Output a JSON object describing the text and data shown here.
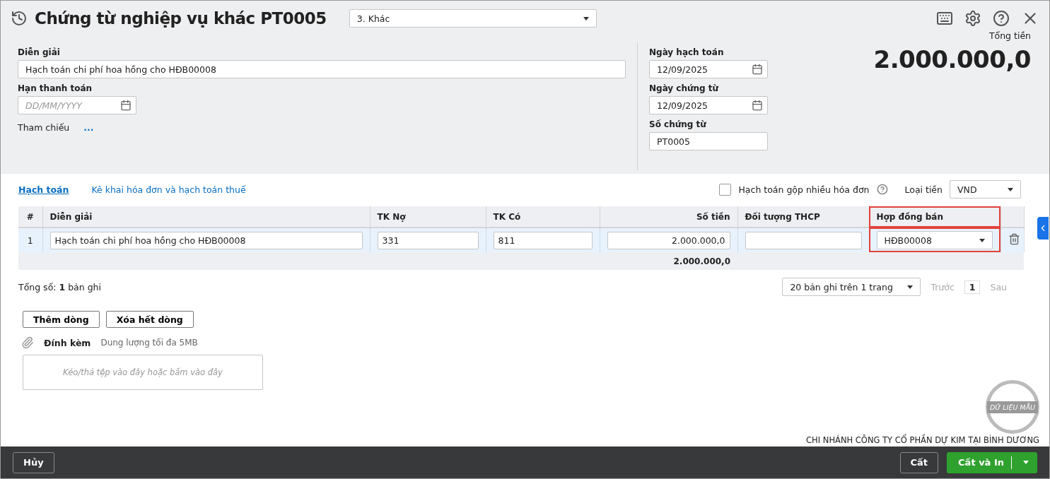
{
  "header": {
    "title": "Chứng từ nghiệp vụ khác PT0005",
    "voucher_type": "3. Khác"
  },
  "form": {
    "description": {
      "label": "Diễn giải",
      "value": "Hạch toán chi phí hoa hồng cho HĐB00008"
    },
    "due_date": {
      "label": "Hạn thanh toán",
      "placeholder": "DD/MM/YYYY"
    },
    "reference": {
      "label": "Tham chiếu",
      "link": "..."
    },
    "posting_date": {
      "label": "Ngày hạch toán",
      "value": "12/09/2025"
    },
    "voucher_date": {
      "label": "Ngày chứng từ",
      "value": "12/09/2025"
    },
    "voucher_no": {
      "label": "Số chứng từ",
      "value": "PT0005"
    },
    "total": {
      "label": "Tổng tiền",
      "value": "2.000.000,0"
    }
  },
  "tabs": [
    {
      "label": "Hạch toán",
      "selected": true
    },
    {
      "label": "Kê khai hóa đơn và hạch toán thuế",
      "selected": false
    }
  ],
  "options": {
    "merge": {
      "label": "Hạch toán gộp nhiều hóa đơn",
      "checked": false
    },
    "currency": {
      "label": "Loại tiền",
      "value": "VND"
    }
  },
  "table": {
    "columns": [
      {
        "label": "#",
        "highlighted": false
      },
      {
        "label": "Diễn giải",
        "highlighted": false
      },
      {
        "label": "TK Nợ",
        "highlighted": false
      },
      {
        "label": "TK Có",
        "highlighted": false
      },
      {
        "label": "Số tiền",
        "highlighted": false
      },
      {
        "label": "Đối tượng THCP",
        "highlighted": false
      },
      {
        "label": "Hợp đồng bán",
        "highlighted": true
      }
    ],
    "rows": [
      {
        "cells": [
          {
            "kind": "index",
            "value": "1"
          },
          {
            "kind": "text",
            "value": "Hạch toán chi phí hoa hồng cho HĐB00008"
          },
          {
            "kind": "text",
            "value": "331"
          },
          {
            "kind": "text",
            "value": "811"
          },
          {
            "kind": "number",
            "value": "2.000.000,0"
          },
          {
            "kind": "text"
          },
          {
            "kind": "select",
            "value": "HĐB00008"
          }
        ]
      }
    ],
    "total": "2.000.000,0"
  },
  "summary": "Tổng số: **1** bản ghi",
  "pager": {
    "page_size": "20 bản ghi trên 1 trang",
    "prev": "Trước",
    "page": "1",
    "next": "Sau"
  },
  "row_buttons": [
    "Thêm dòng",
    "Xóa hết dòng"
  ],
  "attachment": {
    "label": "Đính kèm",
    "hint": "Dung lượng tối đa 5MB",
    "dropzone": "Kéo/thả tệp vào đây hoặc bấm vào đây"
  },
  "stamp": "DỮ LIỆU MẪU",
  "company": "CHI NHÁNH CÔNG TY CỔ PHẦN DỰ KIM TẠI BÌNH DƯƠNG",
  "footer": {
    "cancel": "Hủy",
    "save": "Cất",
    "save_print": "Cất và In"
  }
}
